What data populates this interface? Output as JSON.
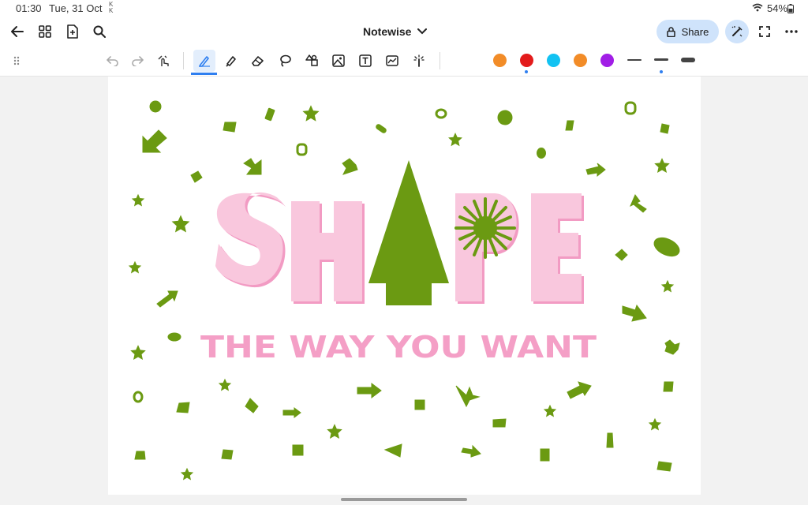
{
  "status_bar": {
    "time": "01:30",
    "date": "Tue, 31 Oct",
    "sim_glyph": "K K",
    "battery": "54%"
  },
  "top_bar": {
    "title": "Notewise",
    "share_label": "Share",
    "icons": [
      "back-arrow-icon",
      "grid-icon",
      "add-page-icon",
      "search-icon",
      "chevron-down-icon",
      "lock-icon",
      "magic-pen-icon",
      "fullscreen-icon",
      "more-icon"
    ]
  },
  "toolbar": {
    "tools": [
      "drag-handle",
      "undo",
      "redo",
      "touch-draw",
      "pen",
      "highlighter",
      "eraser",
      "lasso",
      "shapes",
      "image",
      "text",
      "chart",
      "laser-pointer"
    ],
    "active_tool": "pen",
    "colors": [
      "#f28c28",
      "#e31b1b",
      "#12c2f2",
      "#f28c28",
      "#a11ee6"
    ],
    "selected_color_index": 1,
    "stroke_widths": [
      "thin",
      "medium",
      "thick"
    ],
    "selected_stroke_index": 1
  },
  "canvas": {
    "title_letters": [
      "S",
      "H",
      "P",
      "E"
    ],
    "subtitle": "THE WAY YOU WANT",
    "colors": {
      "shape_green": "#6b9a12",
      "letter_pink": "#f9c7dd",
      "letter_shadow": "#f29bc3",
      "subtitle_pink": "#f49fc6"
    }
  }
}
